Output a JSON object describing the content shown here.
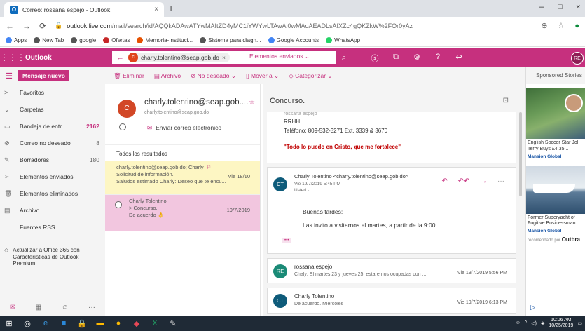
{
  "browser": {
    "tab_title": "Correo: rossana espejo - Outlook",
    "tab_close": "×",
    "new_tab": "+",
    "url_host": "outlook.live.com",
    "url_path": "/mail/search/id/AQQkADAwATYwMAItZD4yMC1iYWYwLTAwAi0wMAoAEADLsAIXZc4gQKZkW%2FOr0yAz",
    "win_min": "–",
    "win_max": "□",
    "win_close": "×"
  },
  "bookmarks": [
    {
      "label": "Apps",
      "color": "#4285f4"
    },
    {
      "label": "New Tab",
      "color": "#555555"
    },
    {
      "label": "google",
      "color": "#555555"
    },
    {
      "label": "Ofertas",
      "color": "#c62828"
    },
    {
      "label": "Memoria-Instituci...",
      "color": "#e65100"
    },
    {
      "label": "Sistema para diagn...",
      "color": "#555555"
    },
    {
      "label": "Google Accounts",
      "color": "#4285f4"
    },
    {
      "label": "WhatsApp",
      "color": "#25d366"
    }
  ],
  "outlook": {
    "brand": "Outlook",
    "accent": "#c6307e",
    "search_chip_initial": "c",
    "search_chip_text": "charly.tolentino@seap.gob.do",
    "search_scope": "Elementos enviados ⌄",
    "user_initials": "RE"
  },
  "leftnav": {
    "new_message": "Mensaje nuevo",
    "items": [
      {
        "icon": ">",
        "label": "Favoritos",
        "count": "",
        "bold": false
      },
      {
        "icon": "⌄",
        "label": "Carpetas",
        "count": "",
        "bold": false
      },
      {
        "icon": "▭",
        "label": "Bandeja de entr...",
        "count": "2162",
        "bold": true
      },
      {
        "icon": "⊘",
        "label": "Correo no deseado",
        "count": "8",
        "bold": false
      },
      {
        "icon": "✎",
        "label": "Borradores",
        "count": "180",
        "bold": false
      },
      {
        "icon": "➢",
        "label": "Elementos enviados",
        "count": "",
        "bold": false
      },
      {
        "icon": "🗑",
        "label": "Elementos eliminados",
        "count": "",
        "bold": false
      },
      {
        "icon": "▤",
        "label": "Archivo",
        "count": "",
        "bold": false
      },
      {
        "icon": "",
        "label": "Fuentes RSS",
        "count": "",
        "bold": false
      }
    ],
    "promo": "Actualizar a Office 365 con Características de Outlook Premium"
  },
  "commandbar": {
    "items": [
      "🗑 Eliminar",
      "▤ Archivo",
      "⊘ No deseado ⌄",
      "▯ Mover a ⌄",
      "◇ Categorizar ⌄",
      "···"
    ]
  },
  "contact": {
    "initial": "C",
    "name": "charly.tolentino@seap.gob....",
    "email": "charly.tolentino@seap.gob.do",
    "send_email": "Enviar correo electrónico"
  },
  "list": {
    "header": "Todos los resultados",
    "messages": [
      {
        "from": "charly.tolentino@seap.gob.do; Charly",
        "subject": "Solicitud de información.",
        "date": "Vie 18/10",
        "preview": "Saludos estimado Charly: Deseo que te encu..."
      },
      {
        "from": "Charly Tolentino",
        "subject": "> Concurso.",
        "date": "19/7/2019",
        "preview": "De acuerdo 👌"
      }
    ]
  },
  "reading": {
    "subject": "Concurso.",
    "sig_name": "rossana espejo",
    "sig_dept": "RRHH",
    "sig_phone": "Teléfono:  809-532-3271 Ext. 3339 & 3670",
    "quote": "\"Todo lo puedo en Cristo, que me fortalece\"",
    "msg1": {
      "initials": "CT",
      "from": "Charly Tolentino <charly.tolentino@seap.gob.do>",
      "date": "Vie 19/7/2019 5:45 PM",
      "to": "Usted ⌄",
      "greeting": "Buenas tardes:",
      "body": "Las invito a visitarnos el martes, a partir de la 9:00."
    },
    "msg2": {
      "initials": "RE",
      "from": "rossana espejo",
      "preview": "Chaly: El martes 23 y jueves 25, estaremos ocupadas con ...",
      "date": "Vie 19/7/2019 5:56 PM"
    },
    "msg3": {
      "initials": "CT",
      "from": "Charly Tolentino",
      "preview": "De acuerdo. Miércoles",
      "date": "Vie 19/7/2019 6:13 PM"
    }
  },
  "ads": {
    "header": "Sponsored Stories",
    "story1_line1": "English Soccer Star Jol",
    "story1_line2": "Terry Buys £4.35...",
    "story1_source": "Mansion Global",
    "story2_line1": "Former Superyacht of",
    "story2_line2": "Fugitive Businessman...",
    "story2_source": "Mansion Global",
    "footer": "recomendado por",
    "footer_brand": "Outbra"
  },
  "taskbar": {
    "time": "10:06 AM",
    "date": "10/25/2019"
  }
}
